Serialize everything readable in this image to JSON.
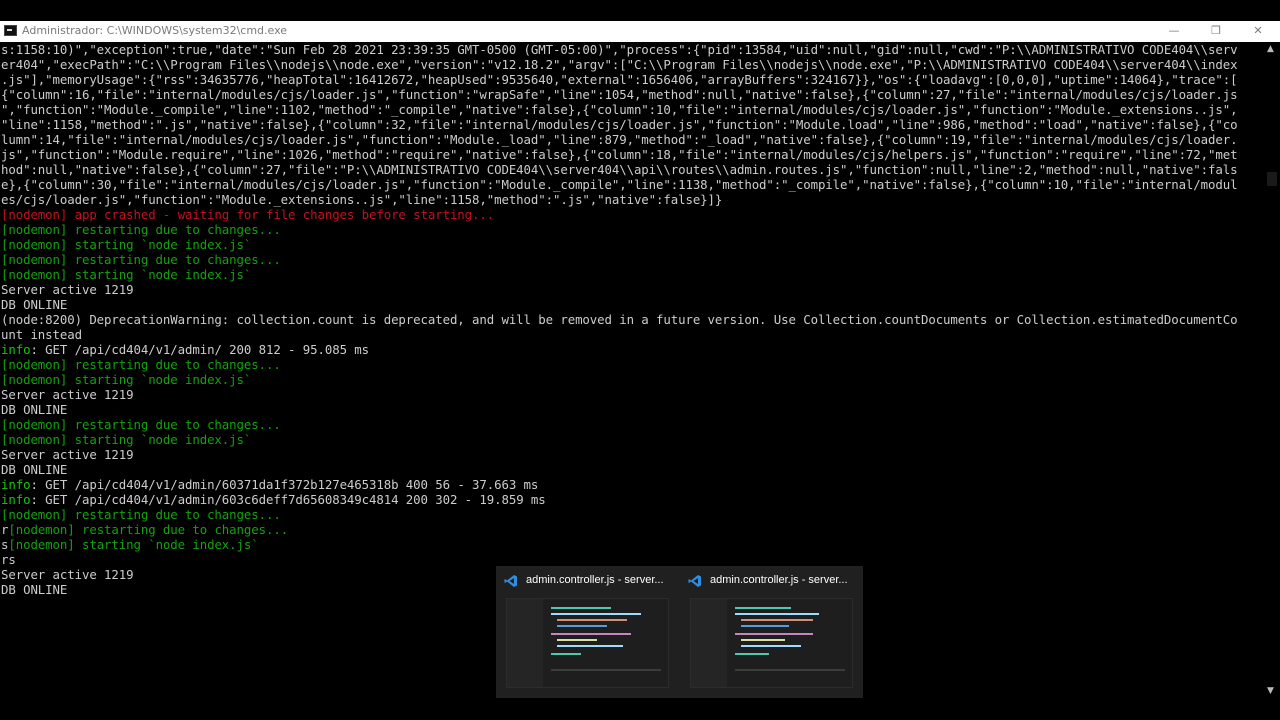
{
  "window": {
    "title": "Administrador: C:\\WINDOWS\\system32\\cmd.exe",
    "minimize": "—",
    "maximize": "❐",
    "close": "✕"
  },
  "console_lines": [
    {
      "parts": [
        {
          "text": "s:1158:10)\",\"exception\":true,\"date\":\"Sun Feb 28 2021 23:39:35 GMT-0500 (GMT-05:00)\",\"process\":{\"pid\":13584,\"uid\":null,\"gid\":null,\"cwd\":\"P:\\\\ADMINISTRATIVO CODE404\\\\serv",
          "color": "white"
        }
      ]
    },
    {
      "parts": [
        {
          "text": "er404\",\"execPath\":\"C:\\\\Program Files\\\\nodejs\\\\node.exe\",\"version\":\"v12.18.2\",\"argv\":[\"C:\\\\Program Files\\\\nodejs\\\\node.exe\",\"P:\\\\ADMINISTRATIVO CODE404\\\\server404\\\\index",
          "color": "white"
        }
      ]
    },
    {
      "parts": [
        {
          "text": ".js\"],\"memoryUsage\":{\"rss\":34635776,\"heapTotal\":16412672,\"heapUsed\":9535640,\"external\":1656406,\"arrayBuffers\":324167}},\"os\":{\"loadavg\":[0,0,0],\"uptime\":14064},\"trace\":[",
          "color": "white"
        }
      ]
    },
    {
      "parts": [
        {
          "text": "{\"column\":16,\"file\":\"internal/modules/cjs/loader.js\",\"function\":\"wrapSafe\",\"line\":1054,\"method\":null,\"native\":false},{\"column\":27,\"file\":\"internal/modules/cjs/loader.js",
          "color": "white"
        }
      ]
    },
    {
      "parts": [
        {
          "text": "\",\"function\":\"Module._compile\",\"line\":1102,\"method\":\"_compile\",\"native\":false},{\"column\":10,\"file\":\"internal/modules/cjs/loader.js\",\"function\":\"Module._extensions..js\",",
          "color": "white"
        }
      ]
    },
    {
      "parts": [
        {
          "text": "\"line\":1158,\"method\":\".js\",\"native\":false},{\"column\":32,\"file\":\"internal/modules/cjs/loader.js\",\"function\":\"Module.load\",\"line\":986,\"method\":\"load\",\"native\":false},{\"co",
          "color": "white"
        }
      ]
    },
    {
      "parts": [
        {
          "text": "lumn\":14,\"file\":\"internal/modules/cjs/loader.js\",\"function\":\"Module._load\",\"line\":879,\"method\":\"_load\",\"native\":false},{\"column\":19,\"file\":\"internal/modules/cjs/loader.",
          "color": "white"
        }
      ]
    },
    {
      "parts": [
        {
          "text": "js\",\"function\":\"Module.require\",\"line\":1026,\"method\":\"require\",\"native\":false},{\"column\":18,\"file\":\"internal/modules/cjs/helpers.js\",\"function\":\"require\",\"line\":72,\"met",
          "color": "white"
        }
      ]
    },
    {
      "parts": [
        {
          "text": "hod\":null,\"native\":false},{\"column\":27,\"file\":\"P:\\\\ADMINISTRATIVO CODE404\\\\server404\\\\api\\\\routes\\\\admin.routes.js\",\"function\":null,\"line\":2,\"method\":null,\"native\":fals",
          "color": "white"
        }
      ]
    },
    {
      "parts": [
        {
          "text": "e},{\"column\":30,\"file\":\"internal/modules/cjs/loader.js\",\"function\":\"Module._compile\",\"line\":1138,\"method\":\"_compile\",\"native\":false},{\"column\":10,\"file\":\"internal/modul",
          "color": "white"
        }
      ]
    },
    {
      "parts": [
        {
          "text": "es/cjs/loader.js\",\"function\":\"Module._extensions..js\",\"line\":1158,\"method\":\".js\",\"native\":false}]}",
          "color": "white"
        }
      ]
    },
    {
      "parts": [
        {
          "text": "[nodemon] app crashed - waiting for file changes before starting...",
          "color": "red"
        }
      ]
    },
    {
      "parts": [
        {
          "text": "[nodemon] restarting due to changes...",
          "color": "green"
        }
      ]
    },
    {
      "parts": [
        {
          "text": "[nodemon] starting `node index.js`",
          "color": "green"
        }
      ]
    },
    {
      "parts": [
        {
          "text": "[nodemon] restarting due to changes...",
          "color": "green"
        }
      ]
    },
    {
      "parts": [
        {
          "text": "[nodemon] starting `node index.js`",
          "color": "green"
        }
      ]
    },
    {
      "parts": [
        {
          "text": "Server active 1219",
          "color": "white"
        }
      ]
    },
    {
      "parts": [
        {
          "text": "DB ONLINE",
          "color": "white"
        }
      ]
    },
    {
      "parts": [
        {
          "text": "(node:8200) DeprecationWarning: collection.count is deprecated, and will be removed in a future version. Use Collection.countDocuments or Collection.estimatedDocumentCo",
          "color": "white"
        }
      ]
    },
    {
      "parts": [
        {
          "text": "unt instead",
          "color": "white"
        }
      ]
    },
    {
      "parts": [
        {
          "text": "info",
          "color": "green2"
        },
        {
          "text": ": GET /api/cd404/v1/admin/ 200 812 - 95.085 ms",
          "color": "white"
        }
      ]
    },
    {
      "parts": [
        {
          "text": "[nodemon] restarting due to changes...",
          "color": "green"
        }
      ]
    },
    {
      "parts": [
        {
          "text": "[nodemon] starting `node index.js`",
          "color": "green"
        }
      ]
    },
    {
      "parts": [
        {
          "text": "Server active 1219",
          "color": "white"
        }
      ]
    },
    {
      "parts": [
        {
          "text": "DB ONLINE",
          "color": "white"
        }
      ]
    },
    {
      "parts": [
        {
          "text": "[nodemon] restarting due to changes...",
          "color": "green"
        }
      ]
    },
    {
      "parts": [
        {
          "text": "[nodemon] starting `node index.js`",
          "color": "green"
        }
      ]
    },
    {
      "parts": [
        {
          "text": "Server active 1219",
          "color": "white"
        }
      ]
    },
    {
      "parts": [
        {
          "text": "DB ONLINE",
          "color": "white"
        }
      ]
    },
    {
      "parts": [
        {
          "text": "info",
          "color": "green2"
        },
        {
          "text": ": GET /api/cd404/v1/admin/60371da1f372b127e465318b 400 56 - 37.663 ms",
          "color": "white"
        }
      ]
    },
    {
      "parts": [
        {
          "text": "info",
          "color": "green2"
        },
        {
          "text": ": GET /api/cd404/v1/admin/603c6deff7d65608349c4814 200 302 - 19.859 ms",
          "color": "white"
        }
      ]
    },
    {
      "parts": [
        {
          "text": "[nodemon] restarting due to changes...",
          "color": "green"
        }
      ]
    },
    {
      "parts": [
        {
          "text": "r",
          "color": "white"
        },
        {
          "text": "[nodemon] restarting due to changes...",
          "color": "green"
        }
      ]
    },
    {
      "parts": [
        {
          "text": "s",
          "color": "white"
        },
        {
          "text": "[nodemon] starting `node index.js`",
          "color": "green"
        }
      ]
    },
    {
      "parts": [
        {
          "text": "rs",
          "color": "white"
        }
      ]
    },
    {
      "parts": [
        {
          "text": "Server active 1219",
          "color": "white"
        }
      ]
    },
    {
      "parts": [
        {
          "text": "DB ONLINE",
          "color": "white"
        }
      ]
    }
  ],
  "taskbar_preview": {
    "items": [
      {
        "icon": "vscode-icon",
        "title": "admin.controller.js - server..."
      },
      {
        "icon": "vscode-icon",
        "title": "admin.controller.js - server..."
      }
    ]
  },
  "colors": {
    "background": "#000000",
    "text": "#cccccc",
    "nodemon_green": "#13a10e",
    "crash_red": "#c50f1f",
    "info_green": "#16c60c",
    "vscode_blue": "#2f8ee0"
  }
}
